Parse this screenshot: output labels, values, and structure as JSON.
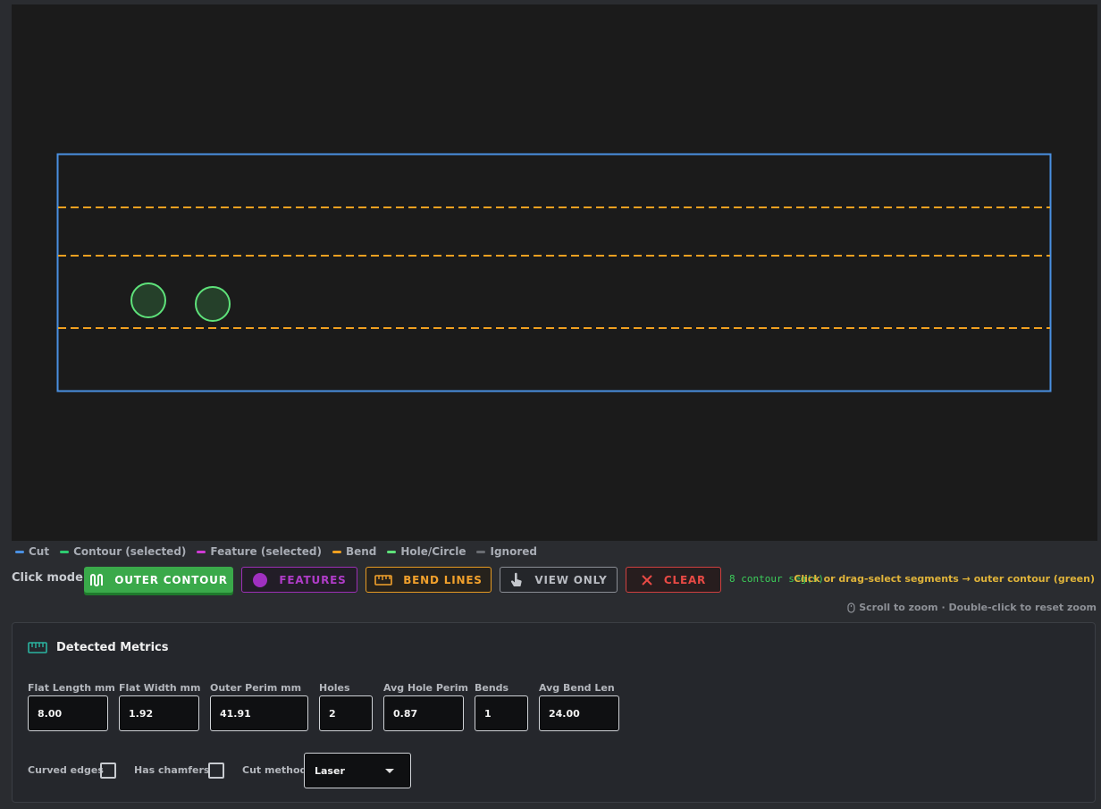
{
  "legend": {
    "items": [
      {
        "label": "Cut",
        "color": "#4a90e2"
      },
      {
        "label": "Contour (selected)",
        "color": "#2ecc71"
      },
      {
        "label": "Feature (selected)",
        "color": "#d03ad6"
      },
      {
        "label": "Bend",
        "color": "#f0a020"
      },
      {
        "label": "Hole/Circle",
        "color": "#5ee27a"
      },
      {
        "label": "Ignored",
        "color": "#6a6d72"
      }
    ]
  },
  "mode_bar": {
    "label": "Click mode:",
    "buttons": {
      "outer_contour": "OUTER CONTOUR",
      "features": "FEATURES",
      "bend_lines": "BEND LINES",
      "view_only": "VIEW ONLY",
      "clear": "CLEAR"
    },
    "active": "outer_contour",
    "segment_count": "8 contour seg(s)",
    "hint": "Click or drag-select segments → outer contour (green)"
  },
  "zoom_hint": "Scroll to zoom · Double-click to reset zoom",
  "metrics": {
    "title": "Detected Metrics",
    "fields": {
      "flat_length": {
        "label": "Flat Length mm",
        "value": "8.00"
      },
      "flat_width": {
        "label": "Flat Width mm",
        "value": "1.92"
      },
      "outer_perim": {
        "label": "Outer Perim mm",
        "value": "41.91"
      },
      "holes": {
        "label": "Holes",
        "value": "2"
      },
      "avg_hole_perim": {
        "label": "Avg Hole Perim",
        "value": "0.87"
      },
      "bends": {
        "label": "Bends",
        "value": "1"
      },
      "avg_bend_len": {
        "label": "Avg Bend Len",
        "value": "24.00"
      }
    },
    "options": {
      "curved_edges": {
        "label": "Curved edges",
        "checked": false
      },
      "has_chamfers": {
        "label": "Has chamfers",
        "checked": false
      },
      "cut_method": {
        "label": "Cut method",
        "value": "Laser"
      }
    }
  },
  "colors": {
    "cut": "#4a90e2",
    "bend": "#f0a020",
    "hole": "#5ee27a",
    "accent_green": "#3aa94a"
  }
}
